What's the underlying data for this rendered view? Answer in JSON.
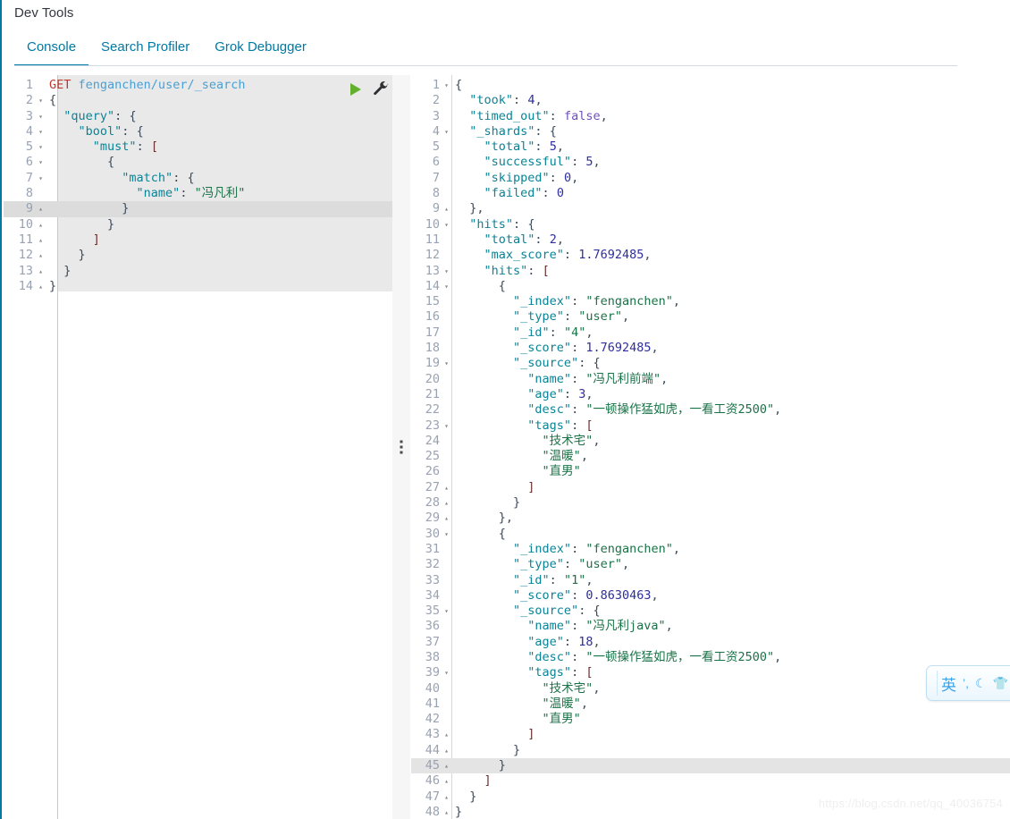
{
  "app": {
    "title": "Dev Tools",
    "accent_color": "#0079a5",
    "watermark": "https://blog.csdn.net/qq_40036754"
  },
  "tabs": [
    {
      "label": "Console",
      "active": true
    },
    {
      "label": "Search Profiler",
      "active": false
    },
    {
      "label": "Grok Debugger",
      "active": false
    }
  ],
  "toolbar": {
    "play_icon": "play-icon",
    "wrench_icon": "wrench-icon"
  },
  "request_editor": {
    "method": "GET",
    "path": "fenganchen/user/_search",
    "highlighted_line": 9,
    "lines": [
      {
        "n": 1,
        "fold": "",
        "text": ""
      },
      {
        "n": 2,
        "fold": "▾",
        "text": "{"
      },
      {
        "n": 3,
        "fold": "▾",
        "text": "  \"query\": {"
      },
      {
        "n": 4,
        "fold": "▾",
        "text": "    \"bool\": {"
      },
      {
        "n": 5,
        "fold": "▾",
        "text": "      \"must\": ["
      },
      {
        "n": 6,
        "fold": "▾",
        "text": "        {"
      },
      {
        "n": 7,
        "fold": "▾",
        "text": "          \"match\": {"
      },
      {
        "n": 8,
        "fold": "",
        "text": "            \"name\": \"冯凡利\""
      },
      {
        "n": 9,
        "fold": "▴",
        "text": "          }"
      },
      {
        "n": 10,
        "fold": "▴",
        "text": "        }"
      },
      {
        "n": 11,
        "fold": "▴",
        "text": "      ]"
      },
      {
        "n": 12,
        "fold": "▴",
        "text": "    }"
      },
      {
        "n": 13,
        "fold": "▴",
        "text": "  }"
      },
      {
        "n": 14,
        "fold": "▴",
        "text": "}"
      }
    ]
  },
  "response_editor": {
    "highlighted_line": 45,
    "lines": [
      {
        "n": 1,
        "fold": "▾",
        "text": "{"
      },
      {
        "n": 2,
        "fold": "",
        "text": "  \"took\": 4,"
      },
      {
        "n": 3,
        "fold": "",
        "text": "  \"timed_out\": false,"
      },
      {
        "n": 4,
        "fold": "▾",
        "text": "  \"_shards\": {"
      },
      {
        "n": 5,
        "fold": "",
        "text": "    \"total\": 5,"
      },
      {
        "n": 6,
        "fold": "",
        "text": "    \"successful\": 5,"
      },
      {
        "n": 7,
        "fold": "",
        "text": "    \"skipped\": 0,"
      },
      {
        "n": 8,
        "fold": "",
        "text": "    \"failed\": 0"
      },
      {
        "n": 9,
        "fold": "▴",
        "text": "  },"
      },
      {
        "n": 10,
        "fold": "▾",
        "text": "  \"hits\": {"
      },
      {
        "n": 11,
        "fold": "",
        "text": "    \"total\": 2,"
      },
      {
        "n": 12,
        "fold": "",
        "text": "    \"max_score\": 1.7692485,"
      },
      {
        "n": 13,
        "fold": "▾",
        "text": "    \"hits\": ["
      },
      {
        "n": 14,
        "fold": "▾",
        "text": "      {"
      },
      {
        "n": 15,
        "fold": "",
        "text": "        \"_index\": \"fenganchen\","
      },
      {
        "n": 16,
        "fold": "",
        "text": "        \"_type\": \"user\","
      },
      {
        "n": 17,
        "fold": "",
        "text": "        \"_id\": \"4\","
      },
      {
        "n": 18,
        "fold": "",
        "text": "        \"_score\": 1.7692485,"
      },
      {
        "n": 19,
        "fold": "▾",
        "text": "        \"_source\": {"
      },
      {
        "n": 20,
        "fold": "",
        "text": "          \"name\": \"冯凡利前端\","
      },
      {
        "n": 21,
        "fold": "",
        "text": "          \"age\": 3,"
      },
      {
        "n": 22,
        "fold": "",
        "text": "          \"desc\": \"一顿操作猛如虎，一看工资2500\","
      },
      {
        "n": 23,
        "fold": "▾",
        "text": "          \"tags\": ["
      },
      {
        "n": 24,
        "fold": "",
        "text": "            \"技术宅\","
      },
      {
        "n": 25,
        "fold": "",
        "text": "            \"温暖\","
      },
      {
        "n": 26,
        "fold": "",
        "text": "            \"直男\""
      },
      {
        "n": 27,
        "fold": "▴",
        "text": "          ]"
      },
      {
        "n": 28,
        "fold": "▴",
        "text": "        }"
      },
      {
        "n": 29,
        "fold": "▴",
        "text": "      },"
      },
      {
        "n": 30,
        "fold": "▾",
        "text": "      {"
      },
      {
        "n": 31,
        "fold": "",
        "text": "        \"_index\": \"fenganchen\","
      },
      {
        "n": 32,
        "fold": "",
        "text": "        \"_type\": \"user\","
      },
      {
        "n": 33,
        "fold": "",
        "text": "        \"_id\": \"1\","
      },
      {
        "n": 34,
        "fold": "",
        "text": "        \"_score\": 0.8630463,"
      },
      {
        "n": 35,
        "fold": "▾",
        "text": "        \"_source\": {"
      },
      {
        "n": 36,
        "fold": "",
        "text": "          \"name\": \"冯凡利java\","
      },
      {
        "n": 37,
        "fold": "",
        "text": "          \"age\": 18,"
      },
      {
        "n": 38,
        "fold": "",
        "text": "          \"desc\": \"一顿操作猛如虎，一看工资2500\","
      },
      {
        "n": 39,
        "fold": "▾",
        "text": "          \"tags\": ["
      },
      {
        "n": 40,
        "fold": "",
        "text": "            \"技术宅\","
      },
      {
        "n": 41,
        "fold": "",
        "text": "            \"温暖\","
      },
      {
        "n": 42,
        "fold": "",
        "text": "            \"直男\""
      },
      {
        "n": 43,
        "fold": "▴",
        "text": "          ]"
      },
      {
        "n": 44,
        "fold": "▴",
        "text": "        }"
      },
      {
        "n": 45,
        "fold": "▴",
        "text": "      }"
      },
      {
        "n": 46,
        "fold": "▴",
        "text": "    ]"
      },
      {
        "n": 47,
        "fold": "▴",
        "text": "  }"
      },
      {
        "n": 48,
        "fold": "▴",
        "text": "}"
      }
    ]
  },
  "ime": {
    "mode_label": "英",
    "punctuation_icon": "punctuation-toggle-icon",
    "moon_icon": "moon-icon",
    "skin_icon": "tshirt-icon"
  }
}
